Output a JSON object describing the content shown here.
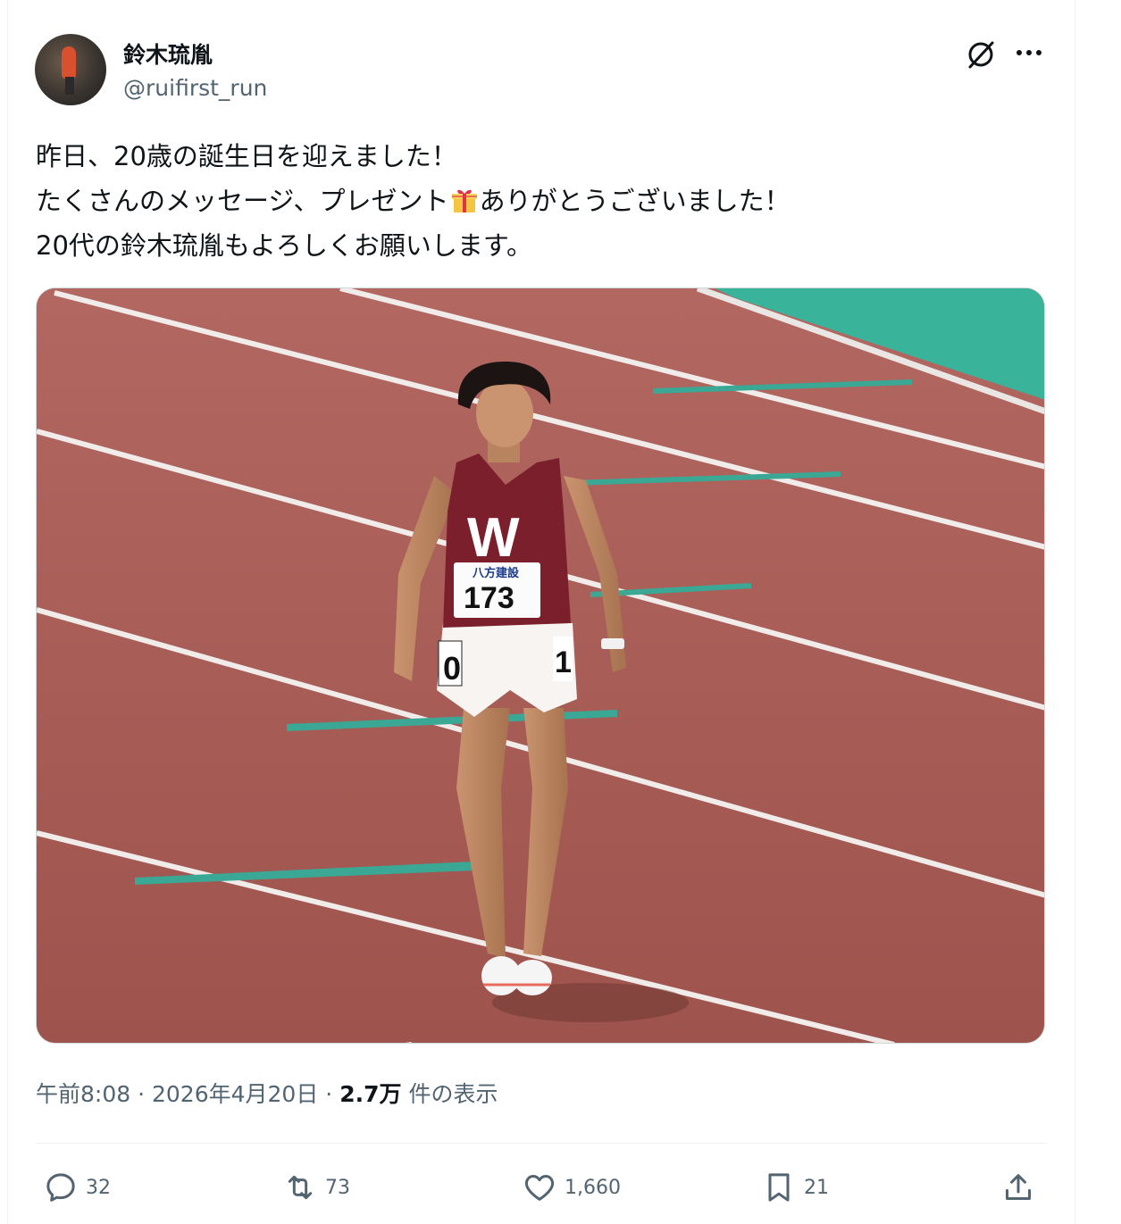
{
  "author": {
    "display_name": "鈴木琉胤",
    "handle": "@ruifirst_run"
  },
  "header_icons": [
    "grok-icon",
    "more-icon"
  ],
  "tweet": {
    "lines": {
      "l1": "昨日、20歳の誕生日を迎えました！",
      "l2a": "たくさんのメッセージ、プレゼント",
      "l2b": "ありがとうございました！",
      "l3": "20代の鈴木琉胤もよろしくお願いします。"
    },
    "emoji": "gift-emoji",
    "image": {
      "bib_sponsor": "八方建設",
      "bib_number": "173",
      "shorts_left": "0",
      "shorts_right": "1"
    }
  },
  "meta": {
    "time": "午前8:08",
    "sep": "·",
    "date": "2026年4月20日",
    "views_count": "2.7万",
    "views_label": "件の表示"
  },
  "actions": {
    "replies": "32",
    "reposts": "73",
    "likes": "1,660",
    "bookmarks": "21"
  },
  "colors": {
    "text": "#0f1419",
    "secondary": "#536471",
    "track": "#a85c55",
    "jersey": "#7a1f2b",
    "infield": "#39b39a"
  }
}
